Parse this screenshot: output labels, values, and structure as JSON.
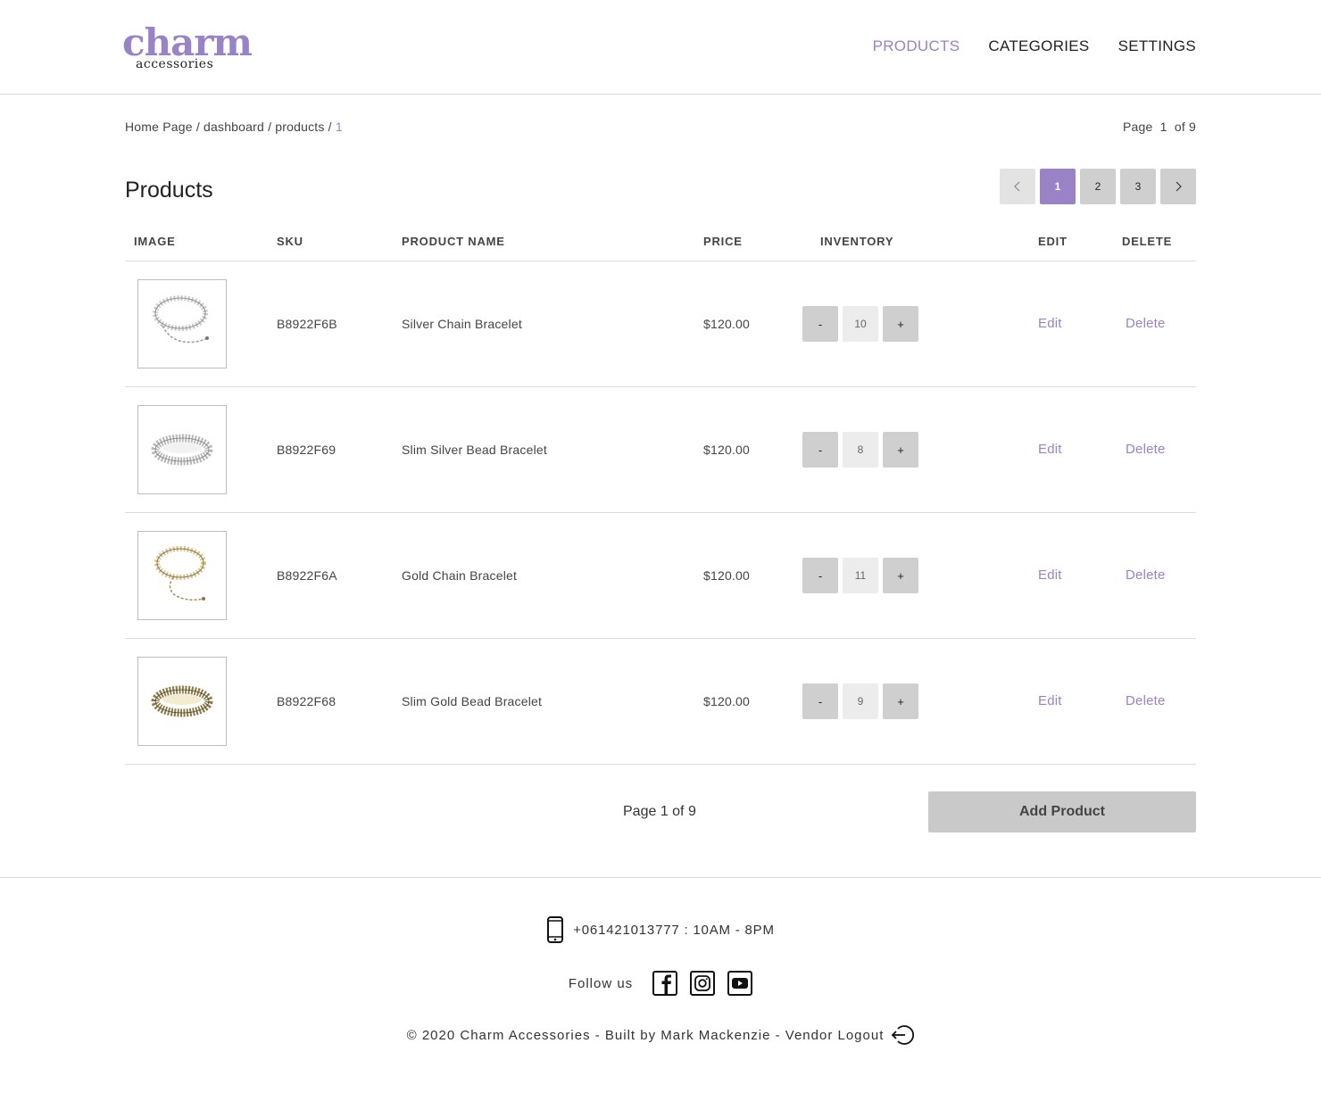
{
  "brand": {
    "name": "charm",
    "sub": "accessories",
    "color": "#9a82c7"
  },
  "nav": {
    "items": [
      {
        "label": "PRODUCTS",
        "active": true
      },
      {
        "label": "CATEGORIES",
        "active": false
      },
      {
        "label": "SETTINGS",
        "active": false
      }
    ]
  },
  "breadcrumb": {
    "items": [
      "Home Page",
      "dashboard",
      "products"
    ],
    "separator": "/",
    "current": "1"
  },
  "page_indicator": "Page  1  of 9",
  "title": "Products",
  "pagination": {
    "pages": [
      "1",
      "2",
      "3"
    ],
    "active": "1"
  },
  "table": {
    "headers": {
      "image": "IMAGE",
      "sku": "SKU",
      "name": "PRODUCT NAME",
      "price": "PRICE",
      "inventory": "INVENTORY",
      "edit": "EDIT",
      "delete": "DELETE"
    },
    "rows": [
      {
        "sku": "B8922F6B",
        "name": "Silver Chain Bracelet",
        "price": "$120.00",
        "minus": "-",
        "inventory": "10",
        "plus": "+",
        "edit": "Edit",
        "delete": "Delete",
        "image": "silver-chain-bracelet-image"
      },
      {
        "sku": "B8922F69",
        "name": "Slim Silver Bead Bracelet",
        "price": "$120.00",
        "minus": "-",
        "inventory": "8",
        "plus": "+",
        "edit": "Edit",
        "delete": "Delete",
        "image": "silver-bead-bracelet-image"
      },
      {
        "sku": "B8922F6A",
        "name": "Gold Chain Bracelet",
        "price": "$120.00",
        "minus": "-",
        "inventory": "11",
        "plus": "+",
        "edit": "Edit",
        "delete": "Delete",
        "image": "gold-chain-bracelet-image"
      },
      {
        "sku": "B8922F68",
        "name": "Slim Gold Bead Bracelet",
        "price": "$120.00",
        "minus": "-",
        "inventory": "9",
        "plus": "+",
        "edit": "Edit",
        "delete": "Delete",
        "image": "gold-bead-bracelet-image"
      }
    ]
  },
  "bottom_page": "Page 1 of 9",
  "add_button": "Add Product",
  "footer": {
    "phone": "+061421013777 : 10AM - 8PM",
    "follow": "Follow us",
    "social": [
      "facebook-icon",
      "instagram-icon",
      "youtube-icon"
    ],
    "copyright": "© 2020 Charm Accessories - Built by Mark Mackenzie - Vendor Logout"
  }
}
